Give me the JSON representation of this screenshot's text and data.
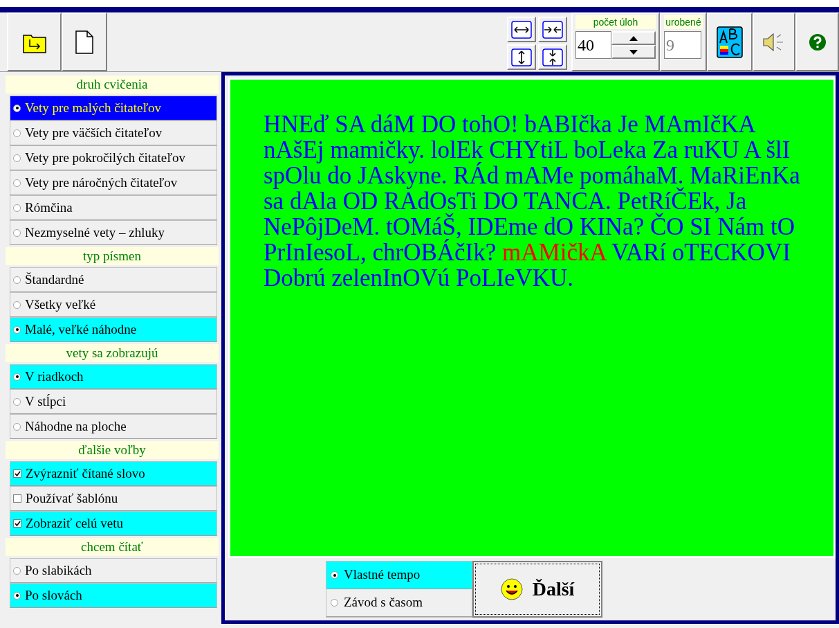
{
  "toolbar": {
    "counter": {
      "label": "počet úloh",
      "value": "40"
    },
    "done": {
      "label": "urobené",
      "value": "9"
    }
  },
  "sidebar": [
    {
      "title": "druh cvičenia",
      "kind": "radio",
      "items": [
        {
          "label": "Vety pre malých čitateľov",
          "selected": true
        },
        {
          "label": "Vety pre väčších čitateľov",
          "selected": false
        },
        {
          "label": "Vety pre pokročilých čitateľov",
          "selected": false
        },
        {
          "label": "Vety pre náročných čitateľov",
          "selected": false
        },
        {
          "label": "Rómčina",
          "selected": false
        },
        {
          "label": "Nezmyselné vety – zhluky",
          "selected": false
        }
      ]
    },
    {
      "title": "typ písmen",
      "kind": "radio",
      "items": [
        {
          "label": "Štandardné",
          "selected": false
        },
        {
          "label": "Všetky veľké",
          "selected": false
        },
        {
          "label": "Malé, veľké náhodne",
          "selected": true
        }
      ]
    },
    {
      "title": "vety sa zobrazujú",
      "kind": "radio",
      "items": [
        {
          "label": "V riadkoch",
          "selected": true
        },
        {
          "label": "V stĺpci",
          "selected": false
        },
        {
          "label": "Náhodne na ploche",
          "selected": false
        }
      ]
    },
    {
      "title": "ďalšie voľby",
      "kind": "checkbox",
      "items": [
        {
          "label": "Zvýrazniť čítané slovo",
          "checked": true
        },
        {
          "label": "Používať šablónu",
          "checked": false
        },
        {
          "label": "Zobraziť celú vetu",
          "checked": true
        }
      ]
    },
    {
      "title": "chcem čítať",
      "kind": "radio",
      "items": [
        {
          "label": "Po slabikách",
          "selected": false
        },
        {
          "label": "Po slovách",
          "selected": true
        }
      ]
    }
  ],
  "reading_text": [
    {
      "text": "HNEď SA dáM DO tohO! bABIčka Je MAmIčKA nAšEj mamičky. lolEk CHYtiL boLeka Za ruKU A šlI spOlu do JAskyne. RÁd mAMe pomáhaM. MaRiEnKa sa dAla OD RAdOsTi DO TANCA. PetRíČEk, Ja NePôjDeM. tOMáŠ, IDEme dO KINa? ČO SI Nám tO PrInIesoL, chrOBÁčIk? ",
      "highlighted": false
    },
    {
      "text": "mAMičkA",
      "highlighted": true
    },
    {
      "text": " VARí oTECKOVI Dobrú zelenInOVú PoLIeVKU.",
      "highlighted": false
    }
  ],
  "tempo": [
    {
      "label": "Vlastné tempo",
      "selected": true
    },
    {
      "label": "Závod s časom",
      "selected": false
    }
  ],
  "next_button": "Ďalší"
}
